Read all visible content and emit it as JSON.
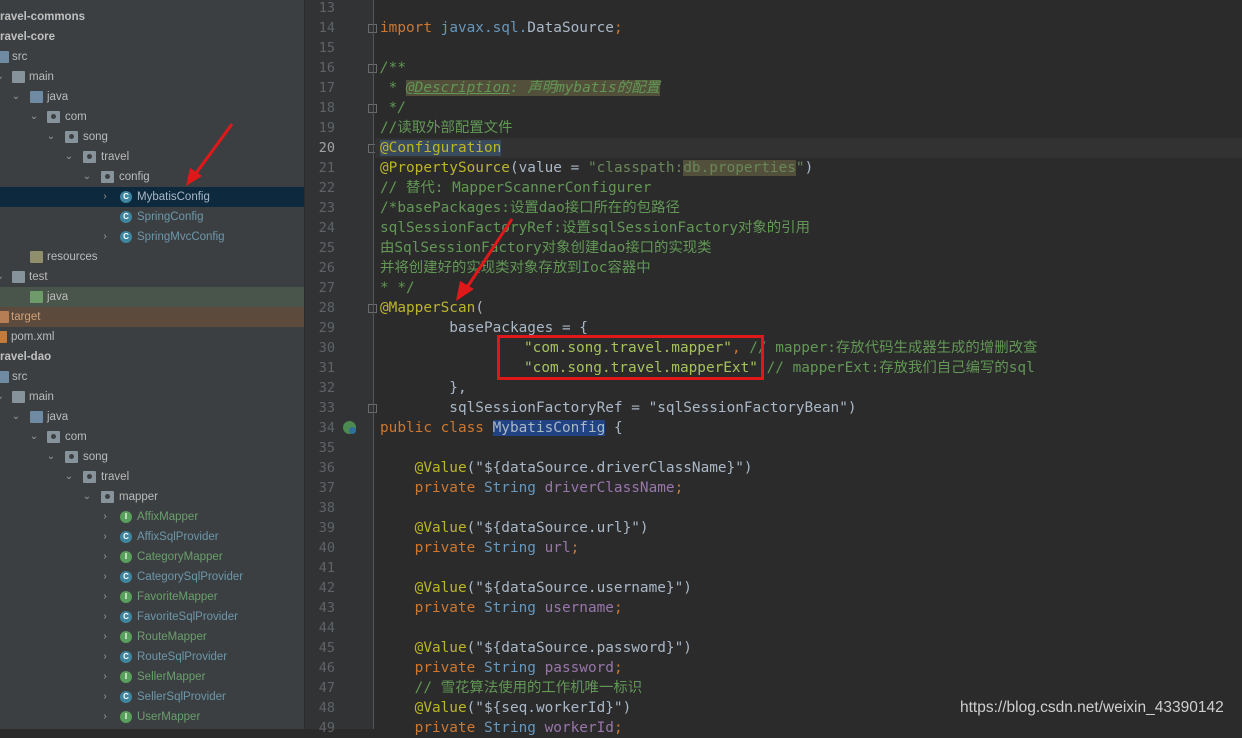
{
  "tree": {
    "rows": [
      {
        "label": "",
        "kind": "folder",
        "indent": 0
      },
      {
        "label": "ravel-commons",
        "kind": "module"
      },
      {
        "label": "ravel-core",
        "kind": "module"
      },
      {
        "label": "src",
        "kind": "src"
      },
      {
        "label": "main",
        "kind": "folder"
      },
      {
        "label": "java",
        "kind": "src"
      },
      {
        "label": "com",
        "kind": "pkg"
      },
      {
        "label": "song",
        "kind": "pkg"
      },
      {
        "label": "travel",
        "kind": "pkg"
      },
      {
        "label": "config",
        "kind": "pkg"
      },
      {
        "label": "MybatisConfig",
        "kind": "class"
      },
      {
        "label": "SpringConfig",
        "kind": "class"
      },
      {
        "label": "SpringMvcConfig",
        "kind": "class"
      },
      {
        "label": "resources",
        "kind": "res"
      },
      {
        "label": "test",
        "kind": "folder"
      },
      {
        "label": "java",
        "kind": "test"
      },
      {
        "label": "target",
        "kind": "target"
      },
      {
        "label": "pom.xml",
        "kind": "xml"
      },
      {
        "label": "ravel-dao",
        "kind": "module"
      },
      {
        "label": "src",
        "kind": "src"
      },
      {
        "label": "main",
        "kind": "folder"
      },
      {
        "label": "java",
        "kind": "src"
      },
      {
        "label": "com",
        "kind": "pkg"
      },
      {
        "label": "song",
        "kind": "pkg"
      },
      {
        "label": "travel",
        "kind": "pkg"
      },
      {
        "label": "mapper",
        "kind": "pkg"
      },
      {
        "label": "AffixMapper",
        "kind": "interface"
      },
      {
        "label": "AffixSqlProvider",
        "kind": "class"
      },
      {
        "label": "CategoryMapper",
        "kind": "interface"
      },
      {
        "label": "CategorySqlProvider",
        "kind": "class"
      },
      {
        "label": "FavoriteMapper",
        "kind": "interface"
      },
      {
        "label": "FavoriteSqlProvider",
        "kind": "class"
      },
      {
        "label": "RouteMapper",
        "kind": "interface"
      },
      {
        "label": "RouteSqlProvider",
        "kind": "class"
      },
      {
        "label": "SellerMapper",
        "kind": "interface"
      },
      {
        "label": "SellerSqlProvider",
        "kind": "class"
      },
      {
        "label": "UserMapper",
        "kind": "interface"
      }
    ]
  },
  "editor": {
    "line_numbers": [
      "13",
      "14",
      "15",
      "16",
      "17",
      "18",
      "19",
      "20",
      "21",
      "22",
      "23",
      "24",
      "25",
      "26",
      "27",
      "28",
      "29",
      "30",
      "31",
      "32",
      "33",
      "34",
      "35",
      "36",
      "37",
      "38",
      "39",
      "40",
      "41",
      "42",
      "43",
      "44",
      "45",
      "46",
      "47",
      "48",
      "49"
    ],
    "current_line": "20",
    "code": {
      "l14_import": "import",
      "l14_pkg": "javax.sql.",
      "l14_cls": "DataSource",
      "l14_semi": ";",
      "l16": "/**",
      "l17_star": " * ",
      "l17_tag": "@Description",
      "l17_text": ": 声明mybatis的配置",
      "l18": " */",
      "l19": "//读取外部配置文件",
      "l20": "@Configuration",
      "l21_ann": "@PropertySource",
      "l21_a": "(value = ",
      "l21_s1": "\"classpath:",
      "l21_s2": "db.properties",
      "l21_s3": "\"",
      "l21_b": ")",
      "l22": "// 替代: MapperScannerConfigurer",
      "l23": "/*basePackages:设置dao接口所在的包路径",
      "l24": "sqlSessionFactoryRef:设置sqlSessionFactory对象的引用",
      "l25": "由SqlSessionFactory对象创建dao接口的实现类",
      "l26": "并将创建好的实现类对象存放到Ioc容器中",
      "l27": "* */",
      "l28_ann": "@MapperScan",
      "l28_paren": "(",
      "l29": "        basePackages = {",
      "l30_str": "\"com.song.travel.mapper\"",
      "l30_comma": ", ",
      "l30_cmt": "// mapper:存放代码生成器生成的增删改查",
      "l31_str": "\"com.song.travel.mapperExt\"",
      "l31_cmt": " // mapperExt:存放我们自己编写的sql",
      "l32": "        },",
      "l33_a": "        sqlSessionFactoryRef = ",
      "l33_str": "\"sqlSessionFactoryBean\"",
      "l33_b": ")",
      "l34_kw": "public class ",
      "l34_cls": "MybatisConfig",
      "l34_brace": " {",
      "l36_ann": "    @Value",
      "l36_str": "(\"${dataSource.driverClassName}\")",
      "l37_kw": "    private ",
      "l37_type": "String ",
      "l37_field": "driverClassName",
      "l37_semi": ";",
      "l39_ann": "    @Value",
      "l39_str": "(\"${dataSource.url}\")",
      "l40_kw": "    private ",
      "l40_type": "String ",
      "l40_field": "url",
      "l40_semi": ";",
      "l42_ann": "    @Value",
      "l42_str": "(\"${dataSource.username}\")",
      "l43_kw": "    private ",
      "l43_type": "String ",
      "l43_field": "username",
      "l43_semi": ";",
      "l45_ann": "    @Value",
      "l45_str": "(\"${dataSource.password}\")",
      "l46_kw": "    private ",
      "l46_type": "String ",
      "l46_field": "password",
      "l46_semi": ";",
      "l47": "    // 雪花算法使用的工作机唯一标识",
      "l48_ann": "    @Value",
      "l48_str": "(\"${seq.workerId}\")",
      "l49_kw": "    private ",
      "l49_type": "String ",
      "l49_field": "workerId",
      "l49_semi": ";"
    }
  },
  "watermark": "https://blog.csdn.net/weixin_43390142",
  "colors": {
    "annotation_red": "#e0181a",
    "selection": "#0d293e"
  }
}
